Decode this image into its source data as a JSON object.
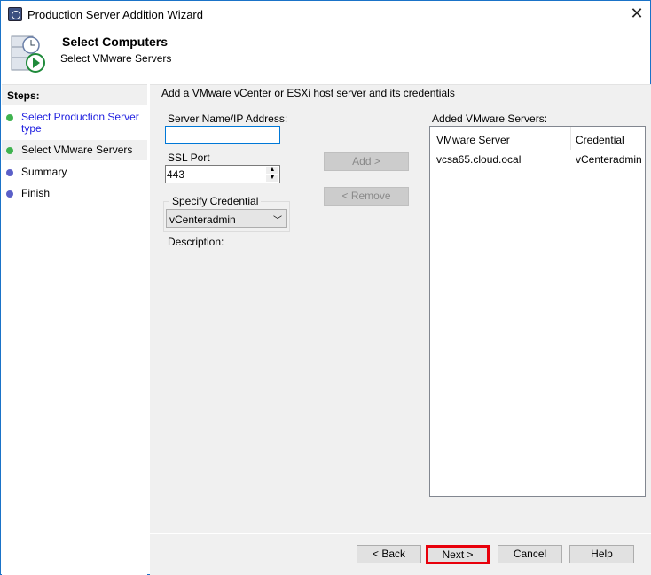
{
  "window": {
    "title": "Production Server Addition Wizard",
    "close": "✕"
  },
  "header": {
    "title": "Select Computers",
    "subtitle": "Select VMware Servers"
  },
  "steps": {
    "heading": "Steps:",
    "items": [
      {
        "label": "Select Production Server type",
        "color": "#3fb34f",
        "link": true
      },
      {
        "label": "Select VMware Servers",
        "color": "#3fb34f",
        "current": true
      },
      {
        "label": "Summary",
        "color": "#5a5fc8"
      },
      {
        "label": "Finish",
        "color": "#5a5fc8"
      }
    ]
  },
  "main": {
    "instruction": "Add a VMware vCenter or ESXi host server and its credentials",
    "server_label": "Server Name/IP Address:",
    "server_value": "",
    "port_label": "SSL Port",
    "port_value": "443",
    "credential_group": "Specify Credential",
    "credential_value": "vCenteradmin",
    "description_label": "Description:",
    "add": "Add >",
    "remove": "< Remove",
    "added_label": "Added VMware Servers:",
    "columns": [
      "VMware Server",
      "Credential"
    ],
    "rows": [
      [
        "vcsa65.cloud.ocal",
        "vCenteradmin"
      ]
    ]
  },
  "footer": {
    "back": "< Back",
    "next": "Next >",
    "cancel": "Cancel",
    "help": "Help"
  }
}
